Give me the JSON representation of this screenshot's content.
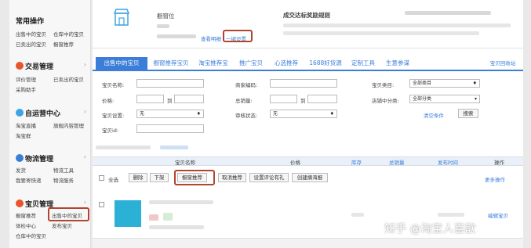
{
  "sidebar": {
    "common": {
      "title": "常用操作",
      "items": [
        "出售中的宝贝",
        "仓库中的宝贝",
        "已卖出的宝贝",
        "橱窗推荐"
      ]
    },
    "trade": {
      "title": "交易管理",
      "items": [
        "评价管理",
        "已卖出的宝贝",
        "采购助手"
      ]
    },
    "service": {
      "title": "自运营中心",
      "items": [
        "淘宝直播",
        "旗舰内容管理",
        "淘宝群"
      ]
    },
    "logistics": {
      "title": "物流管理",
      "items": [
        "发货",
        "物流工具",
        "我要寄快递",
        "物流服务"
      ]
    },
    "goods": {
      "title": "宝贝管理",
      "items": [
        "橱窗推荐",
        "出售中的宝贝",
        "体检中心",
        "发布宝贝",
        "仓库中的宝贝"
      ]
    }
  },
  "top": {
    "window_label": "橱窗位",
    "view_detail": "查看明细",
    "one_click": "一键设置",
    "rule_title": "成交达标奖励规则"
  },
  "tabs": [
    "出售中的宝贝",
    "橱窗推荐宝贝",
    "淘宝推荐宝",
    "推广宝贝",
    "心选推荐",
    "1688好货源",
    "定制工具",
    "生意参谋"
  ],
  "tab_right": "宝贝回收站",
  "filters": {
    "name_label": "宝贝名称:",
    "code_label": "商家编码:",
    "cat_label": "宝贝类目:",
    "cat_value": "全部类目",
    "price_label": "价格:",
    "to1": "到",
    "sales_label": "总销量:",
    "to2": "到",
    "shopcat_label": "店铺中分类:",
    "shopcat_value": "全部分类",
    "setting_label": "宝贝设置:",
    "setting_value": "无",
    "audit_label": "审核状态:",
    "audit_value": "无",
    "clear": "清空条件",
    "search": "搜索",
    "id_label": "宝贝id:"
  },
  "table": {
    "col_name": "宝贝名称",
    "col_price": "价格",
    "col_stock": "库存",
    "col_sales": "总销量",
    "col_date": "发布时间",
    "col_op": "操作",
    "select_all": "全选",
    "actions": [
      "删除",
      "下架",
      "橱窗推荐",
      "取消推荐",
      "设置评论有礼",
      "创建摘海报"
    ],
    "more": "更多操作",
    "edit": "编辑宝贝"
  },
  "watermark": "知乎 @淘宝人喜歆"
}
